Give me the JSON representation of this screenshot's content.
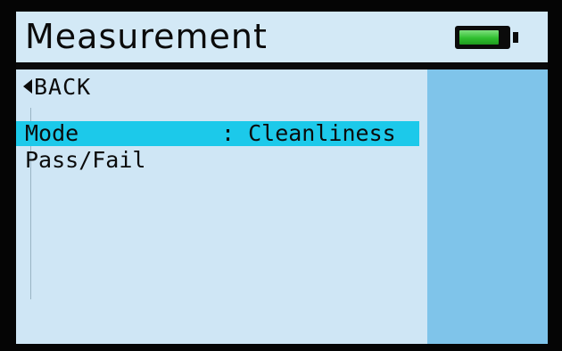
{
  "header": {
    "title": "Measurement",
    "battery_icon": "battery-full-icon",
    "battery_level": 0.85,
    "battery_color": "#2fbf2f"
  },
  "menu": {
    "back_label": "BACK",
    "back_icon": "triangle-left-icon",
    "items": [
      {
        "label": "Mode",
        "value": ": Cleanliness",
        "selected": true
      },
      {
        "label": "Pass/Fail",
        "value": "",
        "selected": false
      }
    ]
  },
  "colors": {
    "highlight": "#1cc9ea",
    "background": "#cfe6f5",
    "side_panel": "#7fc4ea"
  }
}
